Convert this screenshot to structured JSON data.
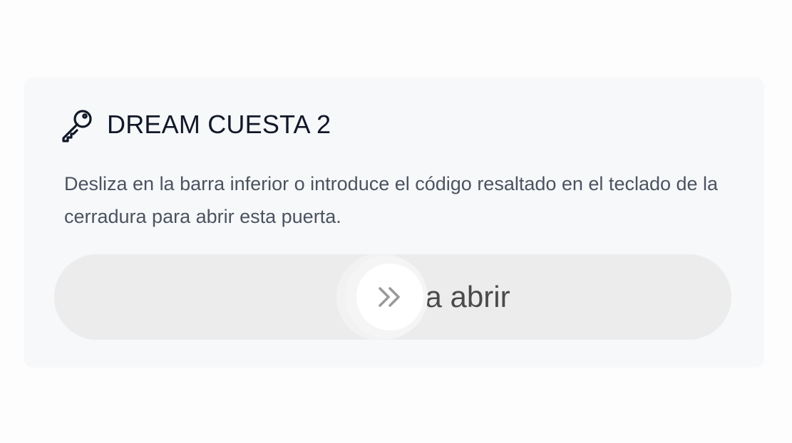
{
  "door": {
    "title": "DREAM CUESTA 2",
    "key_icon": "key-icon",
    "description": "Desliza en la barra inferior o introduce el código resaltado en el teclado de la cerradura para abrir esta puerta."
  },
  "slider": {
    "label": "Desliza para abrir",
    "handle_icon": "double-chevron-right-icon",
    "progress_fraction": 0.42
  },
  "colors": {
    "text_primary": "#111827",
    "text_secondary": "#4b5360",
    "card_background": "#f7f8fa",
    "slider_track": "#ececec",
    "handle_icon": "#9a9a9a"
  }
}
